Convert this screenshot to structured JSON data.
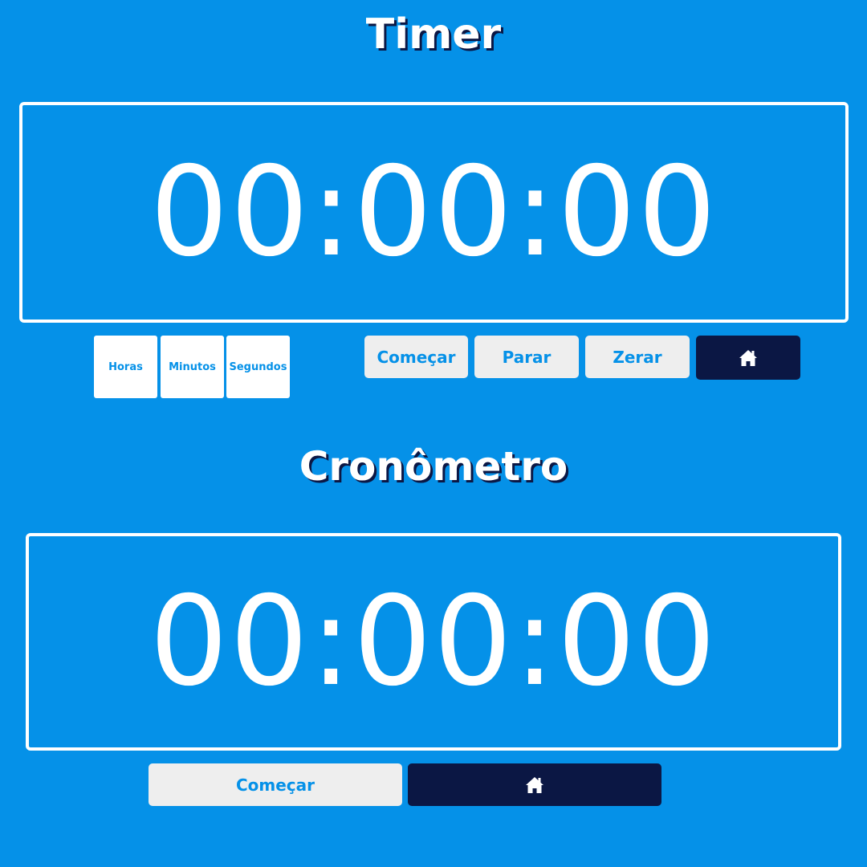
{
  "timer": {
    "title": "Timer",
    "display": "00:00:00",
    "units": {
      "hours_label": "Horas",
      "minutes_label": "Minutos",
      "seconds_label": "Segundos"
    },
    "controls": {
      "start_label": "Começar",
      "stop_label": "Parar",
      "reset_label": "Zerar",
      "home_icon": "home-icon"
    }
  },
  "stopwatch": {
    "title": "Cronômetro",
    "display": "00:00:00",
    "controls": {
      "start_label": "Começar",
      "home_icon": "home-icon"
    }
  },
  "colors": {
    "background": "#0591e8",
    "accent_dark": "#0b1744",
    "button_light": "#eeeeee",
    "text_white": "#ffffff"
  }
}
